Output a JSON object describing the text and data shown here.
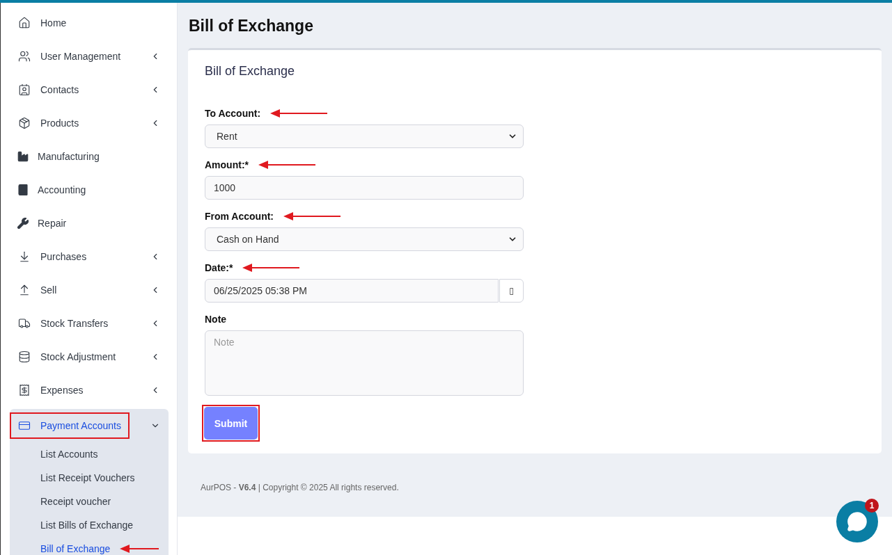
{
  "sidebar": {
    "items": [
      {
        "label": "Home",
        "has_submenu": false,
        "selected": false
      },
      {
        "label": "User Management",
        "has_submenu": true,
        "expanded": false,
        "selected": false
      },
      {
        "label": "Contacts",
        "has_submenu": true,
        "expanded": false,
        "selected": false
      },
      {
        "label": "Products",
        "has_submenu": true,
        "expanded": false,
        "selected": false
      },
      {
        "label": "Manufacturing",
        "has_submenu": false,
        "selected": false
      },
      {
        "label": "Accounting",
        "has_submenu": false,
        "selected": false
      },
      {
        "label": "Repair",
        "has_submenu": false,
        "selected": false
      },
      {
        "label": "Purchases",
        "has_submenu": true,
        "expanded": false,
        "selected": false
      },
      {
        "label": "Sell",
        "has_submenu": true,
        "expanded": false,
        "selected": false
      },
      {
        "label": "Stock Transfers",
        "has_submenu": true,
        "expanded": false,
        "selected": false
      },
      {
        "label": "Stock Adjustment",
        "has_submenu": true,
        "expanded": false,
        "selected": false
      },
      {
        "label": "Expenses",
        "has_submenu": true,
        "expanded": false,
        "selected": false
      },
      {
        "label": "Payment Accounts",
        "has_submenu": true,
        "expanded": true,
        "selected": true,
        "annotated": true,
        "children": [
          {
            "label": "List Accounts",
            "selected": false
          },
          {
            "label": "List Receipt Vouchers",
            "selected": false
          },
          {
            "label": "Receipt voucher",
            "selected": false
          },
          {
            "label": "List Bills of Exchange",
            "selected": false
          },
          {
            "label": "Bill of Exchange",
            "selected": true,
            "annotated": true
          }
        ]
      }
    ]
  },
  "page_title": "Bill of Exchange",
  "card": {
    "title": "Bill of Exchange",
    "fields": [
      {
        "kind": "select",
        "label": "To Account:",
        "value": "Rent",
        "annotated": true
      },
      {
        "kind": "input",
        "label": "Amount:*",
        "value": "1000",
        "annotated": true
      },
      {
        "kind": "select",
        "label": "From Account:",
        "value": "Cash on Hand",
        "annotated": true
      },
      {
        "kind": "date",
        "label": "Date:*",
        "value": "06/25/2025 05:38 PM",
        "button": "▯",
        "annotated": true
      },
      {
        "kind": "textarea",
        "label": "Note",
        "placeholder": "Note"
      }
    ],
    "submit": {
      "label": "Submit",
      "annotated": true
    }
  },
  "footer": "AurPOS - **V6.4** | Copyright © 2025 All rights reserved.",
  "chat": {
    "badge": "1"
  }
}
